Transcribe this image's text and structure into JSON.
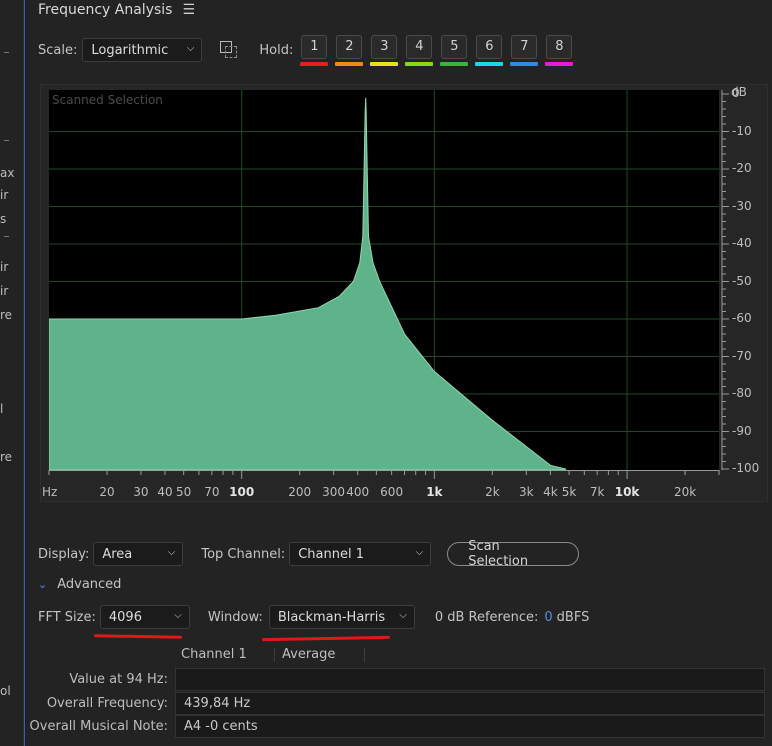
{
  "left_strip": {
    "fragments": [
      "ax",
      "ir",
      "s",
      "ir",
      "ir",
      "re",
      "l",
      "re",
      "ol"
    ]
  },
  "panel": {
    "title": "Frequency Analysis",
    "menu_icon": "hamburger-menu-icon"
  },
  "controls": {
    "scale_label": "Scale:",
    "scale_value": "Logarithmic",
    "hold_label": "Hold:",
    "hold_buttons": [
      {
        "label": "1",
        "color": "#e32020"
      },
      {
        "label": "2",
        "color": "#ee8a1a"
      },
      {
        "label": "3",
        "color": "#e8e01c"
      },
      {
        "label": "4",
        "color": "#88d818"
      },
      {
        "label": "5",
        "color": "#3cb43c"
      },
      {
        "label": "6",
        "color": "#1ad8e8"
      },
      {
        "label": "7",
        "color": "#2e8ae6"
      },
      {
        "label": "8",
        "color": "#e81ad8"
      }
    ]
  },
  "chart_data": {
    "type": "area",
    "title": "Scanned Selection",
    "xlabel": "Hz",
    "ylabel": "dB",
    "x_scale": "log",
    "xlim": [
      10,
      30000
    ],
    "ylim": [
      -100,
      0
    ],
    "grid": true,
    "fill_color": "#5fb38b",
    "x_ticks": [
      {
        "v": 20,
        "label": "20"
      },
      {
        "v": 30,
        "label": "30"
      },
      {
        "v": 40,
        "label": "40"
      },
      {
        "v": 50,
        "label": "50"
      },
      {
        "v": 70,
        "label": "70"
      },
      {
        "v": 100,
        "label": "100"
      },
      {
        "v": 200,
        "label": "200"
      },
      {
        "v": 300,
        "label": "300"
      },
      {
        "v": 400,
        "label": "400"
      },
      {
        "v": 600,
        "label": "600"
      },
      {
        "v": 1000,
        "label": "1k"
      },
      {
        "v": 2000,
        "label": "2k"
      },
      {
        "v": 3000,
        "label": "3k"
      },
      {
        "v": 4000,
        "label": "4k"
      },
      {
        "v": 5000,
        "label": "5k"
      },
      {
        "v": 7000,
        "label": "7k"
      },
      {
        "v": 10000,
        "label": "10k"
      },
      {
        "v": 20000,
        "label": "20k"
      }
    ],
    "bold_ticks": [
      "100",
      "1k",
      "10k"
    ],
    "y_ticks": [
      "0",
      "-10",
      "-20",
      "-30",
      "-40",
      "-50",
      "-60",
      "-70",
      "-80",
      "-90",
      "-100"
    ],
    "x": [
      10,
      100,
      150,
      250,
      320,
      380,
      410,
      425,
      432,
      437,
      440,
      443,
      448,
      455,
      480,
      520,
      700,
      1000,
      2000,
      4000,
      4800
    ],
    "y": [
      -60,
      -60,
      -59,
      -57,
      -54,
      -50,
      -45,
      -38,
      -20,
      -5,
      -1,
      -5,
      -20,
      -38,
      -45,
      -50,
      -64,
      -74,
      -87,
      -99,
      -100
    ]
  },
  "display": {
    "display_label": "Display:",
    "display_value": "Area",
    "top_channel_label": "Top Channel:",
    "top_channel_value": "Channel 1",
    "scan_button": "Scan Selection"
  },
  "advanced": {
    "label": "Advanced",
    "fft_label": "FFT Size:",
    "fft_value": "4096",
    "window_label": "Window:",
    "window_value": "Blackman-Harris",
    "ref_label": "0 dB Reference:",
    "ref_value": "0",
    "ref_unit": "dBFS"
  },
  "table": {
    "columns": [
      "Channel 1",
      "Average"
    ],
    "rows": [
      {
        "label": "Value at 94 Hz:",
        "value": ""
      },
      {
        "label": "Overall Frequency:",
        "value": "439,84 Hz"
      },
      {
        "label": "Overall Musical Note:",
        "value": "A4 -0 cents"
      }
    ]
  }
}
